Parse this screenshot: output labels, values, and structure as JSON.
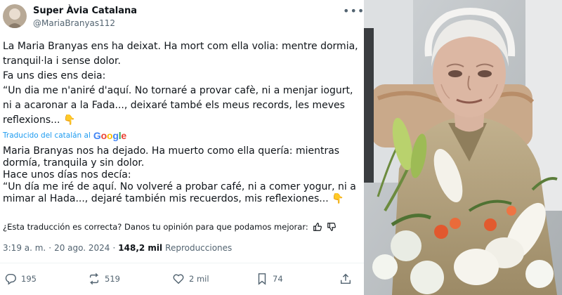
{
  "author": {
    "display_name": "Super Àvia Catalana",
    "handle": "@MariaBranyas112"
  },
  "tweet": {
    "original_text": "La Maria Branyas ens ha deixat. Ha mort com ella volia: mentre dormia, tranquil·la i sense dolor.\nFa uns dies ens deia:\n“Un dia me n'aniré d'aquí. No tornaré a provar cafè, ni a menjar iogurt, ni a acaronar a la Fada..., deixaré també els meus records, les meves reflexions... 👇",
    "translated_by_label": "Traducido del catalán al",
    "translation_provider": "Google",
    "translated_text": "Maria Branyas nos ha dejado. Ha muerto como ella quería: mientras dormía, tranquila y sin dolor.\nHace unos días nos decía:\n“Un día me iré de aquí. No volveré a probar café, ni a comer yogur, ni a mimar al Hada..., dejaré también mis recuerdos, mis reflexiones... 👇",
    "feedback_prompt": "¿Esta traducción es correcta? Danos tu opinión para que podamos mejorar:",
    "time": "3:19 a. m.",
    "separator": "·",
    "date": "20 ago. 2024",
    "views_count": "148,2 mil",
    "views_label": "Reproducciones"
  },
  "actions": {
    "replies": "195",
    "reposts": "519",
    "likes": "2 mil",
    "bookmarks": "74"
  },
  "colors": {
    "text": "#0f1419",
    "secondary": "#536471",
    "link": "#1d9bf0",
    "repost_green": "#00ba7c"
  }
}
